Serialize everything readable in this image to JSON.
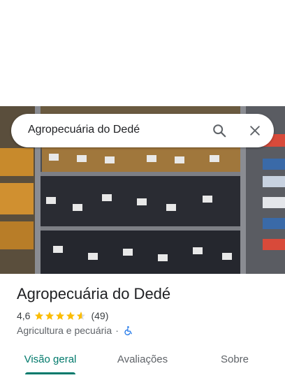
{
  "search": {
    "query": "Agropecuária do Dedé",
    "search_icon": "search-icon",
    "close_icon": "close-icon"
  },
  "place": {
    "name": "Agropecuária do Dedé",
    "rating": "4,6",
    "rating_value": 4.6,
    "review_count": "(49)",
    "category": "Agricultura e pecuária",
    "separator": "·",
    "accessibility_icon": "wheelchair-icon"
  },
  "tabs": [
    {
      "label": "Visão geral",
      "active": true
    },
    {
      "label": "Avaliações",
      "active": false
    },
    {
      "label": "Sobre",
      "active": false
    }
  ],
  "colors": {
    "accent": "#00796b",
    "star": "#fbbc04",
    "accessibility": "#1a73e8"
  }
}
